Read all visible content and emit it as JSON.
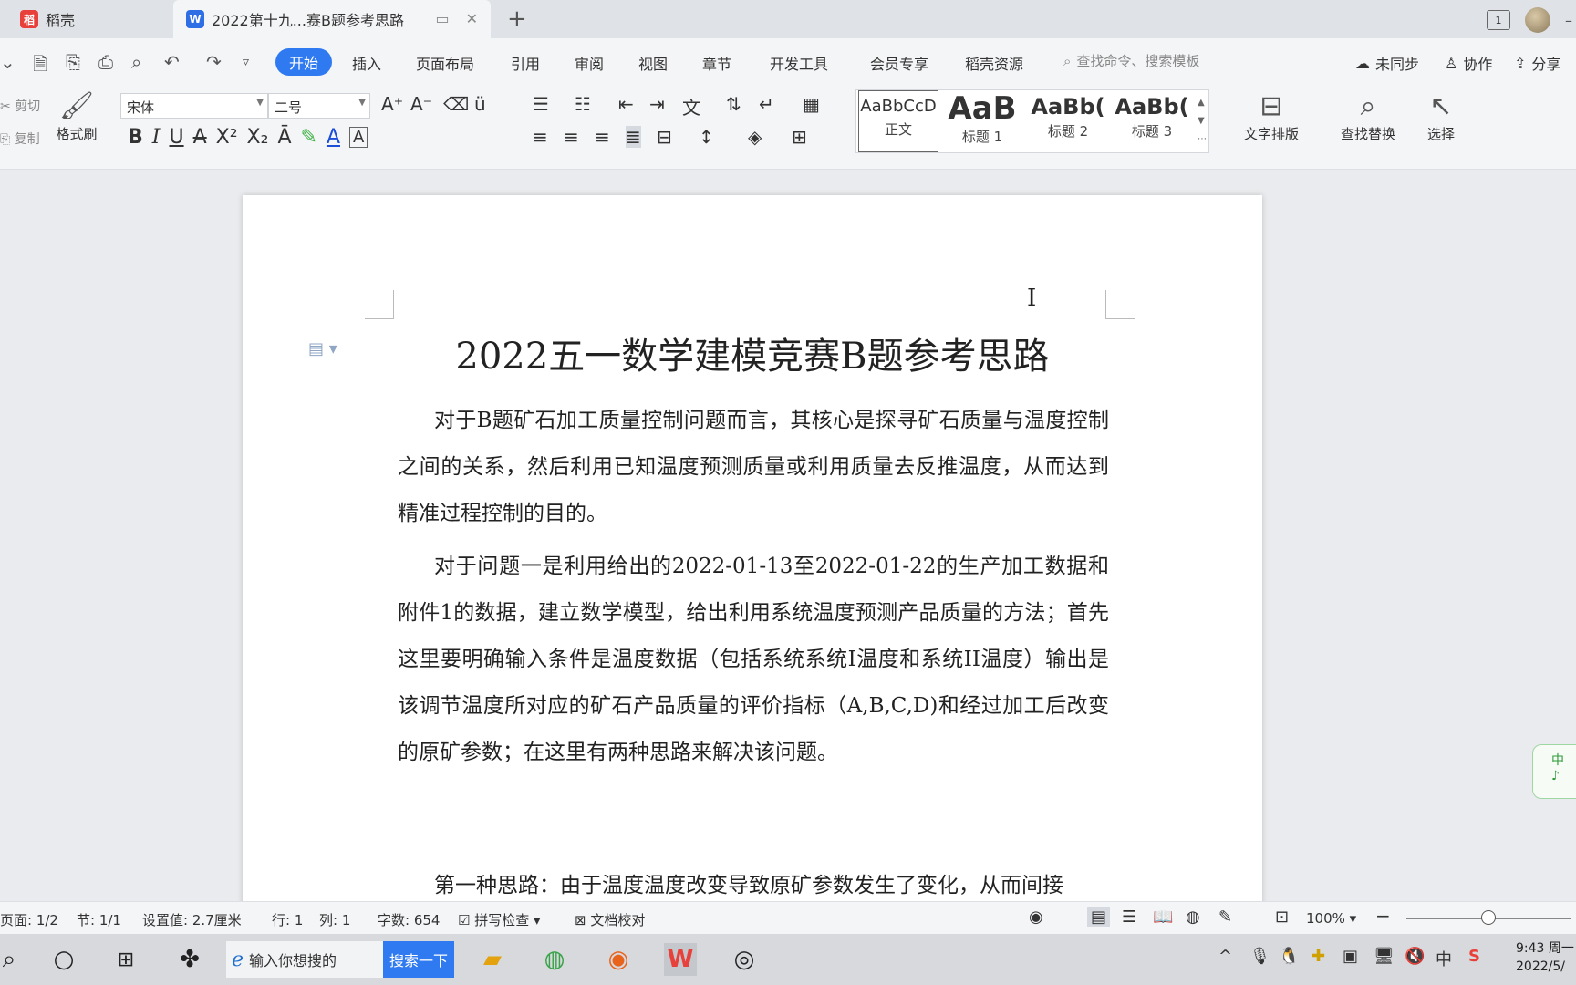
{
  "tabs": [
    {
      "label": "稻壳",
      "icon": "daoke-logo-icon"
    },
    {
      "label": "2022第十九...赛B题参考思路",
      "icon": "wps-writer-icon"
    }
  ],
  "menu": {
    "items": [
      "开始",
      "插入",
      "页面布局",
      "引用",
      "审阅",
      "视图",
      "章节",
      "开发工具",
      "会员专享",
      "稻壳资源"
    ],
    "active": "开始",
    "search_placeholder": "查找命令、搜索模板",
    "sync": "未同步",
    "collab": "协作",
    "share": "分享"
  },
  "ribbon": {
    "cut": "剪切",
    "copy": "复制",
    "format_painter": "格式刷",
    "font_name": "宋体",
    "font_size": "二号",
    "styles": [
      {
        "sample": "AaBbCcD",
        "name": "正文"
      },
      {
        "sample": "AaB",
        "name": "标题 1"
      },
      {
        "sample": "AaBb(",
        "name": "标题 2"
      },
      {
        "sample": "AaBb(",
        "name": "标题 3"
      }
    ],
    "text_layout": "文字排版",
    "find_replace": "查找替换",
    "select": "选择"
  },
  "document": {
    "title": "2022五一数学建模竞赛B题参考思路",
    "paragraphs": [
      "对于B题矿石加工质量控制问题而言，其核心是探寻矿石质量与温度控制之间的关系，然后利用已知温度预测质量或利用质量去反推温度，从而达到精准过程控制的目的。",
      "对于问题一是利用给出的2022-01-13至2022-01-22的生产加工数据和附件1的数据，建立数学模型，给出利用系统温度预测产品质量的方法；首先这里要明确输入条件是温度数据（包括系统系统I温度和系统II温度）输出是该调节温度所对应的矿石产品质量的评价指标（A,B,C,D)和经过加工后改变的原矿参数；在这里有两种思路来解决该问题。",
      "第一种思路：由于温度温度改变导致原矿参数发生了变化，从而间接"
    ],
    "side_widget": "中"
  },
  "status": {
    "page": "页面: 1/2",
    "section": "节: 1/1",
    "setting": "设置值: 2.7厘米",
    "row": "行: 1",
    "col": "列: 1",
    "wordcount": "字数: 654",
    "spellcheck": "拼写检查",
    "proofread": "文档校对",
    "zoom": "100%",
    "zoom_level": 0.5
  },
  "taskbar": {
    "search_placeholder": "输入你想搜的",
    "search_button": "搜索一下",
    "ime": "中",
    "time": "9:43 周一",
    "date": "2022/5/"
  }
}
